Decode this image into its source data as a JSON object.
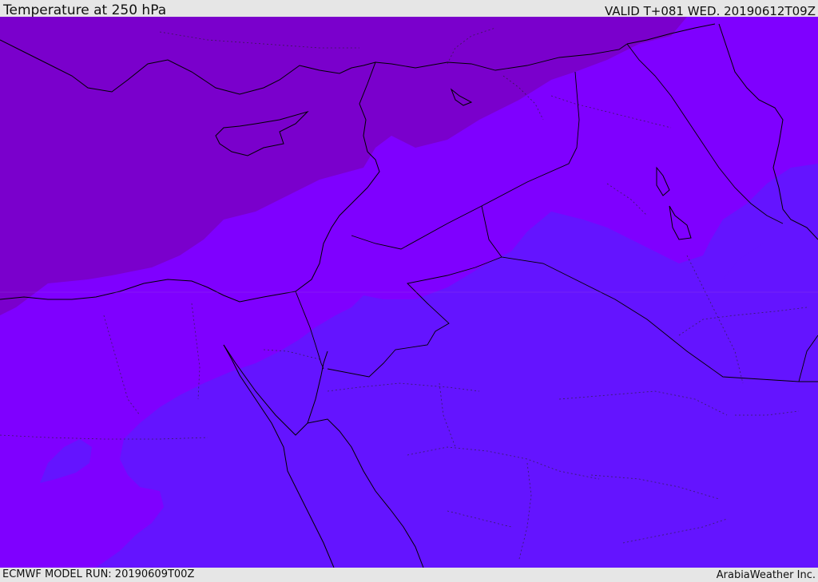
{
  "header": {
    "title": "Temperature at 250 hPa",
    "valid_time": "VALID T+081 WED. 20190612T09Z"
  },
  "footer": {
    "model_run": "ECMWF MODEL RUN: 20190609T00Z",
    "credit": "ArabiaWeather Inc."
  },
  "map": {
    "variable": "Temperature",
    "level": "250 hPa",
    "region": "Eastern Mediterranean and Middle East",
    "colors": {
      "coldest_band": "#7a00cc",
      "middle_band": "#7f00ff",
      "warmest_band": "#6414ff",
      "coastline": "#000000",
      "border": "#000000"
    }
  }
}
